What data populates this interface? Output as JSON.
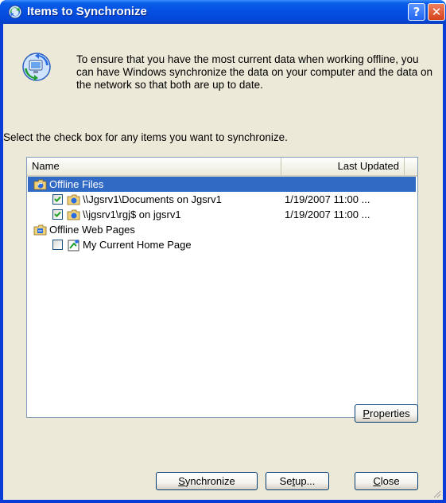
{
  "window": {
    "title": "Items to Synchronize",
    "help_glyph": "?",
    "close_glyph": "✕"
  },
  "intro_text": "To ensure that you have the most current data when working offline, you can have Windows synchronize the data on your computer and the data on the network so that both are up to date.",
  "instruction_text": "Select the check box for any items you want to synchronize.",
  "list": {
    "columns": [
      "Name",
      "Last Updated"
    ],
    "groups": [
      {
        "name": "Offline Files",
        "selected": true,
        "items": [
          {
            "name": "\\\\Jgsrv1\\Documents on Jgsrv1",
            "last_updated": "1/19/2007 11:00 ...",
            "checked": true
          },
          {
            "name": "\\\\jgsrv1\\rgj$ on jgsrv1",
            "last_updated": "1/19/2007 11:00 ...",
            "checked": true
          }
        ]
      },
      {
        "name": "Offline Web Pages",
        "selected": false,
        "items": [
          {
            "name": "My Current Home Page",
            "last_updated": "",
            "checked": false
          }
        ]
      }
    ]
  },
  "buttons": {
    "properties": {
      "key": "P",
      "rest": "roperties"
    },
    "synchronize": {
      "key": "S",
      "rest": "ynchronize"
    },
    "setup_pre": "Se",
    "setup_key": "t",
    "setup_post": "up...",
    "close": {
      "key": "C",
      "rest": "lose"
    }
  },
  "colors": {
    "title_blue": "#0450e3",
    "dialog_bg": "#ece9d8",
    "selection": "#316ac5",
    "check": "#21a121"
  }
}
